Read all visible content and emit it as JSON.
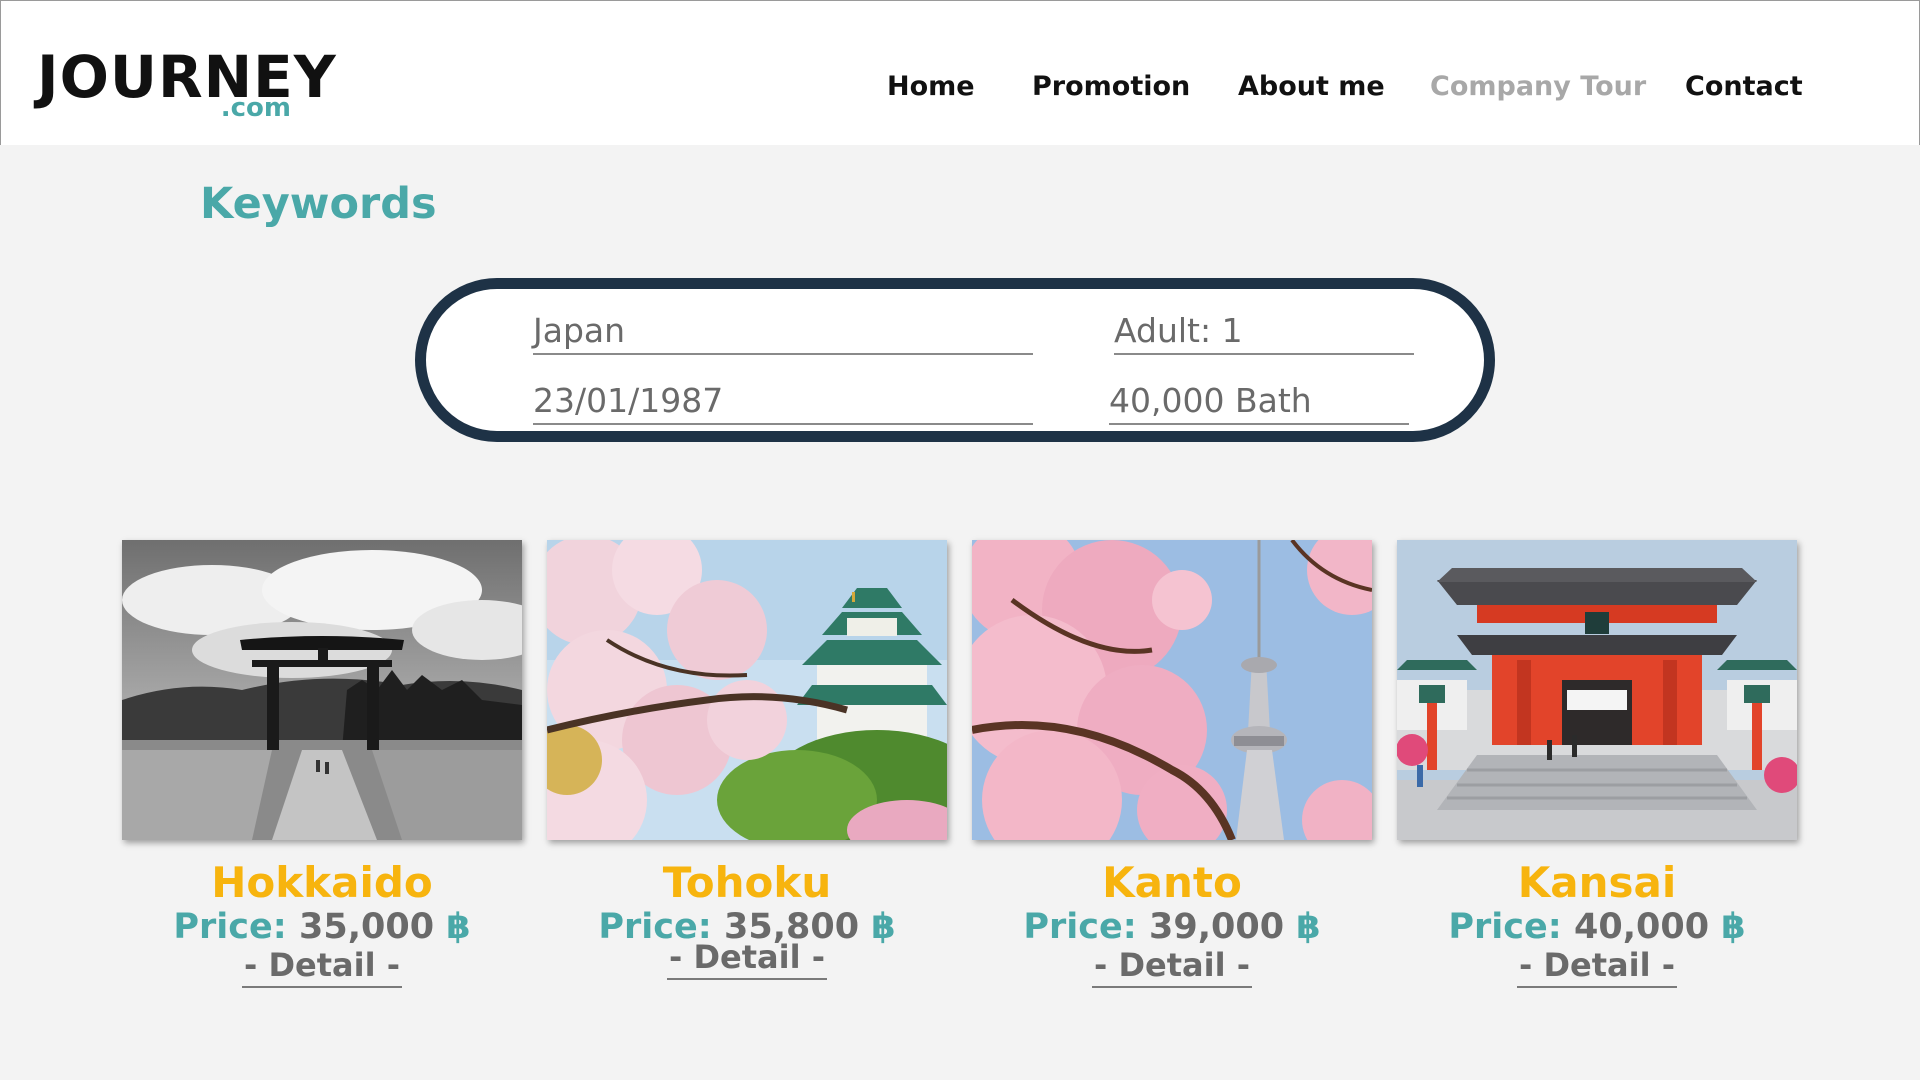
{
  "header": {
    "logo_main": "JOURNEY",
    "logo_sub": ".com",
    "nav": [
      {
        "label": "Home"
      },
      {
        "label": "Promotion"
      },
      {
        "label": "About me"
      },
      {
        "label": "Company Tour",
        "active": true
      },
      {
        "label": "Contact"
      }
    ]
  },
  "search": {
    "title": "Keywords",
    "destination": "Japan",
    "date": "23/01/1987",
    "guests": "Adult: 1",
    "budget": "40,000 Bath"
  },
  "tours": [
    {
      "name": "Hokkaido",
      "price_label": "Price:",
      "price": "35,000",
      "currency": "฿",
      "detail": "- Detail -",
      "image_icon": "torii-gate-photo"
    },
    {
      "name": "Tohoku",
      "price_label": "Price:",
      "price": "35,800",
      "currency": "฿",
      "detail": "- Detail -",
      "image_icon": "castle-blossom-photo"
    },
    {
      "name": "Kanto",
      "price_label": "Price:",
      "price": "39,000",
      "currency": "฿",
      "detail": "- Detail -",
      "image_icon": "tower-blossom-photo"
    },
    {
      "name": "Kansai",
      "price_label": "Price:",
      "price": "40,000",
      "currency": "฿",
      "detail": "- Detail -",
      "image_icon": "shrine-gate-photo"
    }
  ],
  "colors": {
    "accent_teal": "#4aa8a8",
    "title_yellow": "#f7b40e",
    "panel_border": "#1e3246",
    "background": "#f3f3f3"
  }
}
